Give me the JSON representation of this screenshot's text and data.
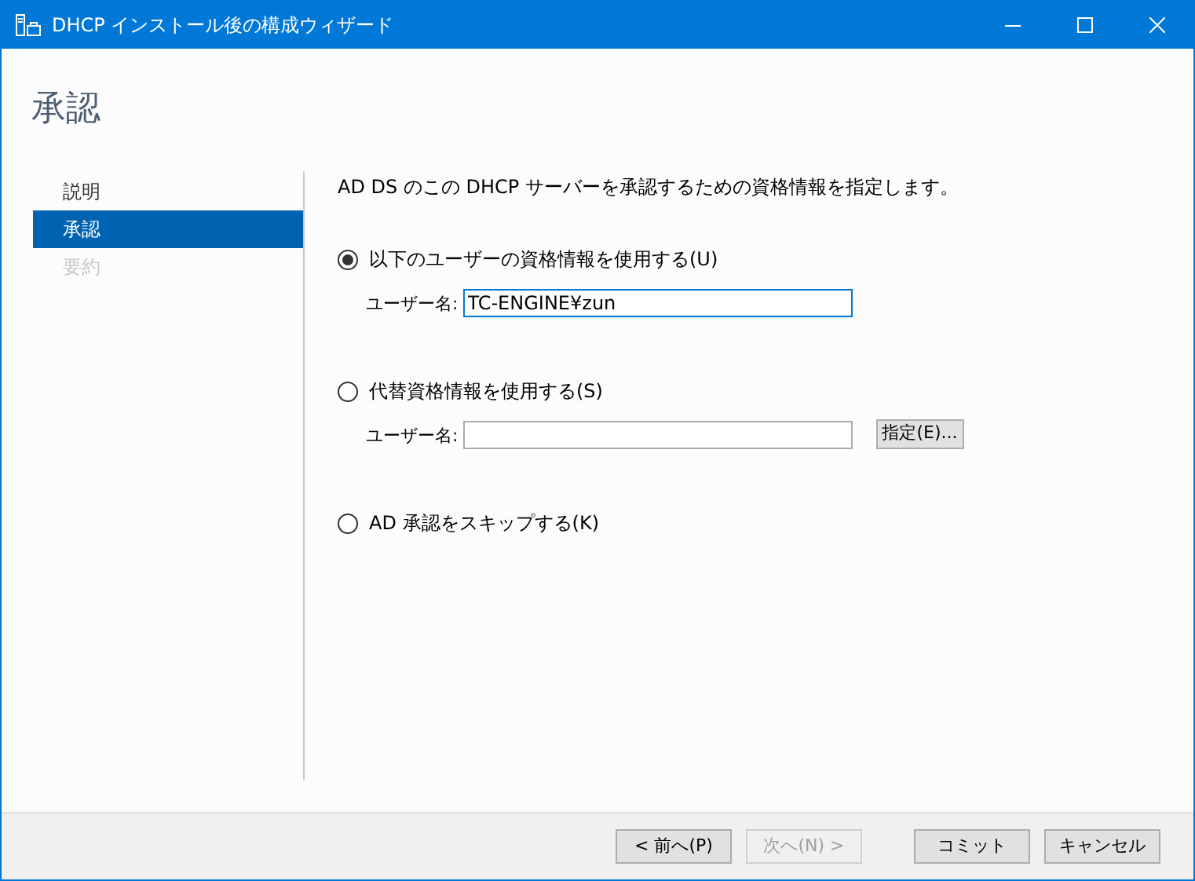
{
  "window": {
    "title": "DHCP インストール後の構成ウィザード"
  },
  "heading": "承認",
  "steps": [
    {
      "label": "説明",
      "selected": false,
      "disabled": false
    },
    {
      "label": "承認",
      "selected": true,
      "disabled": false
    },
    {
      "label": "要約",
      "selected": false,
      "disabled": true
    }
  ],
  "description": "AD DS のこの DHCP サーバーを承認するための資格情報を指定します。",
  "options": [
    {
      "kind": "field",
      "label": "以下のユーザーの資格情報を使用する(U)",
      "selected": true,
      "field_label": "ユーザー名:",
      "value": "TC-ENGINE¥zun"
    },
    {
      "kind": "field_button",
      "label": "代替資格情報を使用する(S)",
      "selected": false,
      "field_label": "ユーザー名:",
      "button": "指定(E)..."
    },
    {
      "kind": "plain",
      "label": "AD 承認をスキップする(K)",
      "selected": false
    }
  ],
  "buttons": [
    {
      "label": "< 前へ(P)",
      "disabled": false
    },
    {
      "label": "次へ(N) >",
      "disabled": true
    },
    {
      "label": "コミット",
      "disabled": false
    },
    {
      "label": "キャンセル",
      "disabled": false
    }
  ]
}
